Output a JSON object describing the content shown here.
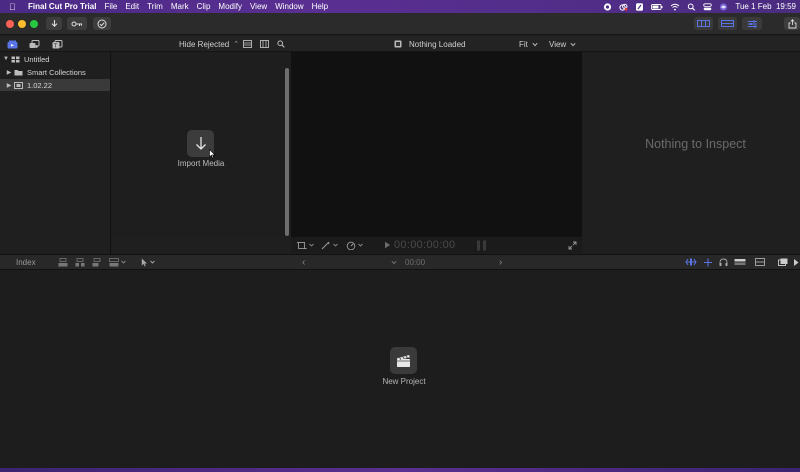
{
  "menubar": {
    "app_name": "Final Cut Pro Trial",
    "items": [
      "File",
      "Edit",
      "Trim",
      "Mark",
      "Clip",
      "Modify",
      "View",
      "Window",
      "Help"
    ],
    "clock": "Tue 1 Feb  19:59"
  },
  "browser_bar": {
    "filter_label": "Hide Rejected",
    "filter_chevron": "⌃",
    "viewer_title": "Nothing Loaded",
    "fit_label": "Fit",
    "view_label": "View"
  },
  "library": {
    "items": [
      {
        "label": "Untitled",
        "expanded": true
      },
      {
        "label": "Smart Collections",
        "expanded": false
      },
      {
        "label": "1.02.22",
        "expanded": false,
        "selected": true
      }
    ]
  },
  "browser": {
    "import_label": "Import Media"
  },
  "viewer": {
    "timecode": "00:00:00:00"
  },
  "inspector": {
    "empty_message": "Nothing to Inspect"
  },
  "timeline_bar": {
    "index_label": "Index",
    "timecode": "00:00",
    "prev_glyph": "‹",
    "next_glyph": "›"
  },
  "timeline": {
    "new_project_label": "New Project"
  },
  "colors": {
    "menubar": "#4b2a86",
    "close": "#ff5f57",
    "minimize": "#febc2e",
    "zoom": "#28c840",
    "accent_blue": "#5a74e6"
  }
}
